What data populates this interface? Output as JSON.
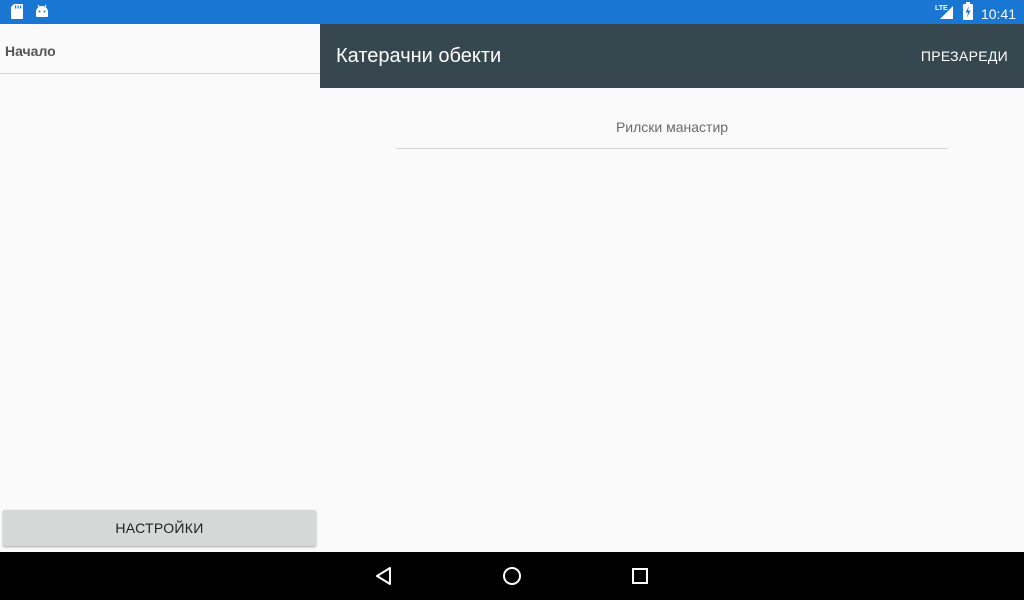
{
  "status_bar": {
    "time": "10:41",
    "network": "LTE",
    "icons": [
      "sd-card-icon",
      "android-icon",
      "signal-icon",
      "battery-charging-icon"
    ]
  },
  "drawer": {
    "items": [
      {
        "label": "Начало"
      }
    ],
    "settings_button_label": "НАСТРОЙКИ"
  },
  "toolbar": {
    "title": "Катерачни обекти",
    "action_label": "ПРЕЗАРЕДИ"
  },
  "list": {
    "items": [
      {
        "label": "Рилски манастир"
      }
    ]
  },
  "nav_bar": {
    "buttons": [
      "back-icon",
      "home-icon",
      "recents-icon"
    ]
  },
  "colors": {
    "status_bar": "#1976d2",
    "toolbar": "#37474f",
    "background": "#fafafa",
    "button": "#d6d7d7"
  }
}
